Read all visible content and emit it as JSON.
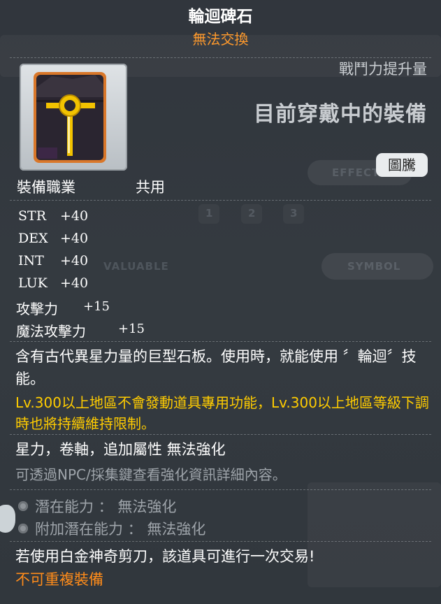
{
  "item": {
    "name": "輪迴碑石",
    "trade_status": "無法交換",
    "combat_power_label": "戰鬥力提升量",
    "currently_equipped_label": "目前穿戴中的裝備",
    "badge_label": "圖騰",
    "job_label": "裝備職業",
    "job_value": "共用"
  },
  "stats": [
    {
      "name": "STR",
      "value": "+40"
    },
    {
      "name": "DEX",
      "value": "+40"
    },
    {
      "name": "INT",
      "value": "+40"
    },
    {
      "name": "LUK",
      "value": "+40"
    },
    {
      "name": "攻擊力",
      "value": "+15"
    },
    {
      "name": "魔法攻擊力",
      "value": "+15"
    }
  ],
  "description": "含有古代異星力量的巨型石板。使用時，就能使用 〞輪迴〞技能。",
  "warning": "Lv.300以上地區不會發動道具專用功能，Lv.300以上地區等級下調時也將持續維持限制。",
  "enhancement": {
    "line1": "星力，卷軸，追加屬性 無法強化",
    "line2": "可透過NPC/採集鍵查看強化資訊詳細內容。"
  },
  "potential": {
    "line1": "潛在能力 ： 無法強化",
    "line2": "附加潛在能力 ： 無法強化"
  },
  "trade_note": "若使用白金神奇剪刀，該道具可進行一次交易!",
  "restriction": "不可重複裝備",
  "background_hints": {
    "effect": "EFFECT",
    "valuable": "VALUABLE",
    "symbol": "SYMBOL",
    "tabs": [
      "1",
      "2",
      "3"
    ]
  },
  "colors": {
    "title": "#ffffff",
    "trade_status": "#ff9a2c",
    "warning": "#ffcc00",
    "restriction": "#ff8c1a",
    "muted": "#9ea4aa",
    "panel": "#343a40"
  }
}
